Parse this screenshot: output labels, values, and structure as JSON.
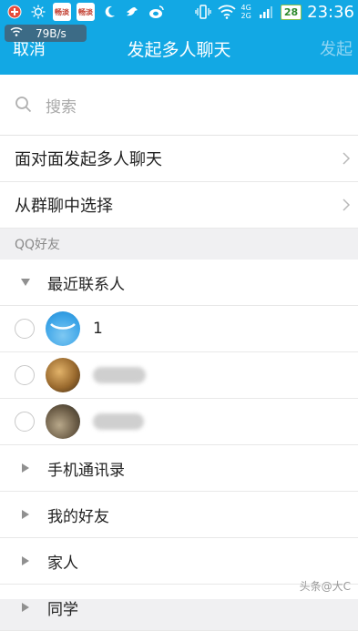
{
  "status_bar": {
    "icons": [
      "add-icon",
      "brightness-icon",
      "app-icon",
      "app-icon",
      "moon-icon",
      "bird-icon",
      "weibo-icon"
    ],
    "app_badge_1": "畅淡",
    "app_badge_2": "畅淡",
    "network_4g": "4G",
    "network_2g": "2G",
    "battery": "28",
    "time": "23:36",
    "speed": "79B/s"
  },
  "header": {
    "cancel": "取消",
    "title": "发起多人聊天",
    "confirm": "发起"
  },
  "search": {
    "placeholder": "搜索"
  },
  "options": [
    {
      "label": "面对面发起多人聊天"
    },
    {
      "label": "从群聊中选择"
    }
  ],
  "section": {
    "title": "QQ好友"
  },
  "groups": {
    "recent": {
      "label": "最近联系人",
      "expanded": true
    },
    "collapsed": [
      {
        "label": "手机通讯录"
      },
      {
        "label": "我的好友"
      },
      {
        "label": "家人"
      },
      {
        "label": "同学"
      }
    ]
  },
  "contacts": [
    {
      "name": "1"
    },
    {
      "name": ""
    },
    {
      "name": ""
    }
  ],
  "watermark": "头条@大C"
}
